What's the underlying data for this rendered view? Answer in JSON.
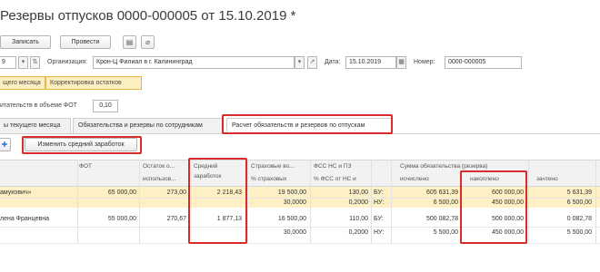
{
  "title": "Резервы отпусков 0000-000005 от 15.10.2019 *",
  "toolbar": {
    "record_label": "Записать",
    "post_label": "Провести",
    "list_icon": "list-icon",
    "attach_icon": "paperclip-icon"
  },
  "header": {
    "small_value": "9",
    "org_label": "Организация:",
    "org_value": "Крон-Ц Филиал в г. Калининград",
    "date_label": "Дата:",
    "date_value": "15.10.2019",
    "number_label": "Номер:",
    "number_value": "0000-000005"
  },
  "form_tabs": [
    "щего месяца",
    "Корректировка остатков"
  ],
  "fot": {
    "label": "итательств в объеме ФОТ",
    "value": "0,10"
  },
  "tabs": [
    "ы текущего месяца",
    "Обязательства и резервы по сотрудникам",
    "Расчет обязательств и резервов по отпускам"
  ],
  "change_avg_button": "Изменить средний заработок",
  "table": {
    "headers": {
      "fot": "ФОТ",
      "ost_top": "Остаток о...",
      "ost_bottom": "использов...",
      "avg_top": "Средний",
      "avg_bottom": "заработок",
      "strah_top": "Страховые во...",
      "strah_bottom": "% страховых",
      "fss_top": "ФСС НС и ПЗ",
      "fss_bottom": "% ФСС от НС и",
      "sum_top": "Сумма обязательства (резерва)",
      "calc": "исчислено",
      "accrued": "накоплено",
      "used": "зачтено"
    },
    "rows": [
      {
        "name": "амукович»",
        "fot": "65 000,00",
        "ost": "273,00",
        "avg": "2 218,43",
        "strah": "19 500,00",
        "strah2": "30,0000",
        "fss": "130,00",
        "fss2": "0,2000",
        "bu": "БУ:",
        "nu": "НУ:",
        "calc_bu": "605 631,39",
        "calc_nu": "6 500,00",
        "acc_bu": "600 000,00",
        "acc_nu": "450 000,00",
        "used_bu": "5 631,39",
        "used_nu": "6 500,00"
      },
      {
        "name": "лена Францевна",
        "fot": "55 000,00",
        "ost": "270,67",
        "avg": "1 877,13",
        "strah": "16 500,00",
        "strah2": "30,0000",
        "fss": "110,00",
        "fss2": "0,2000",
        "bu": "БУ:",
        "nu": "НУ:",
        "calc_bu": "500 082,78",
        "calc_nu": "5 500,00",
        "acc_bu": "500 000,00",
        "acc_nu": "450 000,00",
        "used_bu": "0 082,78",
        "used_nu": "5 500,00"
      }
    ]
  },
  "colors": {
    "highlight_row": "#fcf0c4",
    "annotation_red": "#d72c2c",
    "active_tab_border": "#e8b84a"
  }
}
